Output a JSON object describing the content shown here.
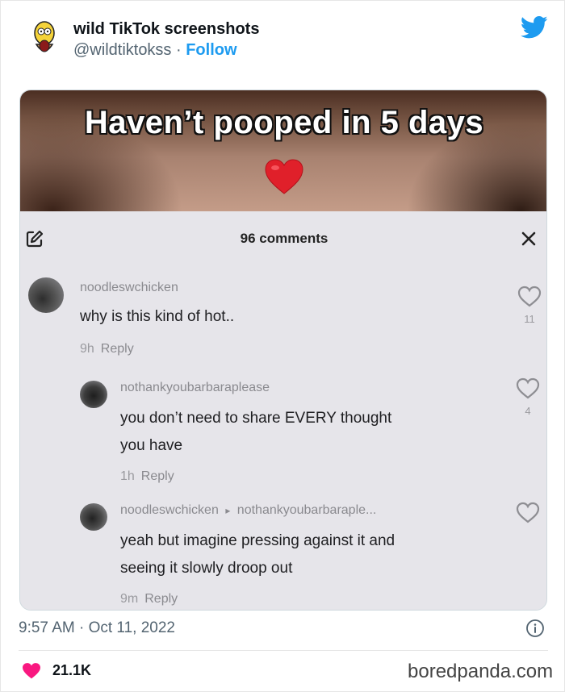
{
  "tweet": {
    "display_name": "wild TikTok screenshots",
    "handle": "@wildtiktokss",
    "separator": " · ",
    "follow_label": "Follow",
    "timestamp": "9:57 AM · Oct 11, 2022",
    "likes": "21.1K"
  },
  "tiktok": {
    "video_caption": "Haven’t pooped in 5 days",
    "comments_count": "96 comments",
    "comments": [
      {
        "user": "noodleswchicken",
        "text": "why is this kind of hot..",
        "time": "9h",
        "reply_label": "Reply",
        "likes": "11"
      },
      {
        "user": "nothankyoubarbaraplease",
        "text_line1": "you don’t need to share EVERY thought",
        "text_line2": "you have",
        "time": "1h",
        "reply_label": "Reply",
        "likes": "4"
      },
      {
        "user": "noodleswchicken",
        "arrow": "▸",
        "reply_to": "nothankyoubarbaraple...",
        "text_line1": "yeah but imagine pressing against it and",
        "text_line2": "seeing it slowly droop out",
        "time": "9m",
        "reply_label": "Reply"
      }
    ]
  },
  "watermark": "boredpanda.com",
  "colors": {
    "accent": "#1d9bf0",
    "like_heart": "#f91880"
  },
  "icons": [
    "homer-avatar-icon",
    "twitter-bird-icon",
    "red-heart-emoji-icon",
    "edit-icon",
    "close-icon",
    "heart-outline-icon",
    "info-icon",
    "heart-filled-icon"
  ]
}
